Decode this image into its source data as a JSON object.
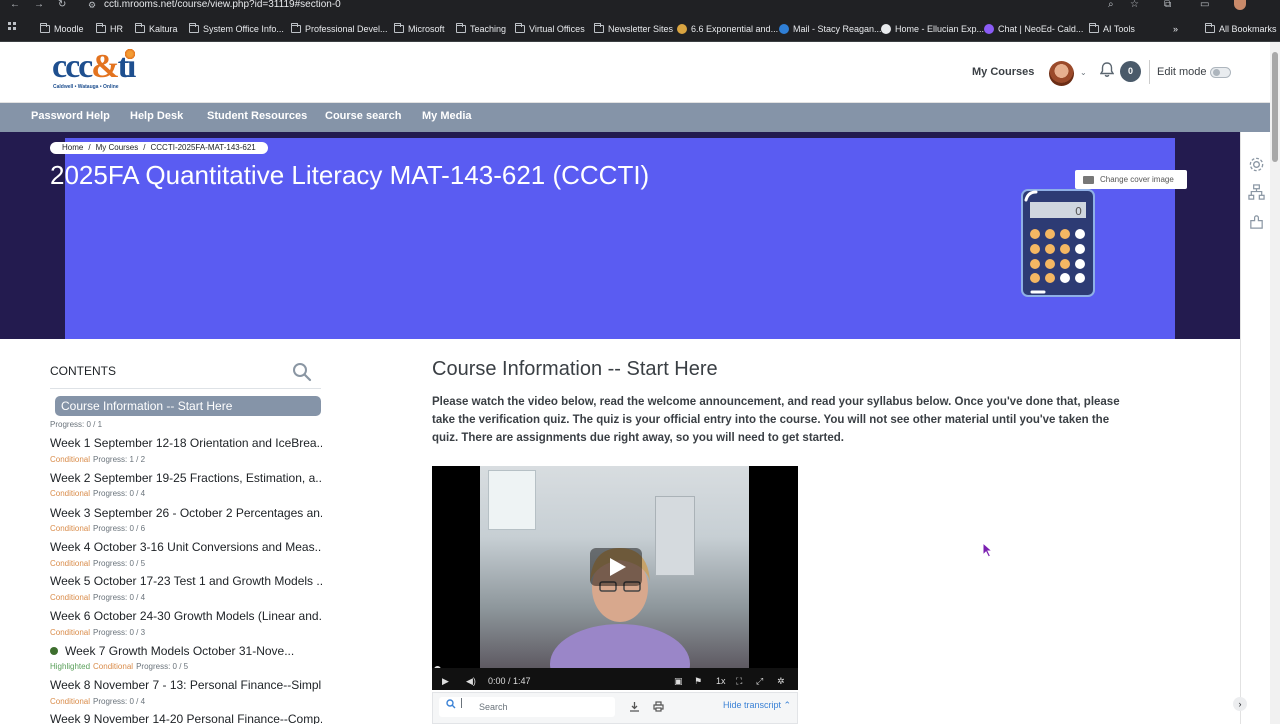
{
  "browser": {
    "url": "ccti.mrooms.net/course/view.php?id=31119#section-0",
    "bookmarks": [
      {
        "label": "Moodle",
        "type": "folder"
      },
      {
        "label": "HR",
        "type": "folder"
      },
      {
        "label": "Kaltura",
        "type": "folder"
      },
      {
        "label": "System Office Info...",
        "type": "folder"
      },
      {
        "label": "Professional Devel...",
        "type": "folder"
      },
      {
        "label": "Microsoft",
        "type": "folder"
      },
      {
        "label": "Teaching",
        "type": "folder"
      },
      {
        "label": "Virtual Offices",
        "type": "folder"
      },
      {
        "label": "Newsletter Sites",
        "type": "folder"
      },
      {
        "label": "6.6 Exponential and...",
        "type": "site"
      },
      {
        "label": "Mail - Stacy Reagan...",
        "type": "site"
      },
      {
        "label": "Home - Ellucian Exp...",
        "type": "site"
      },
      {
        "label": "Chat | NeoEd- Cald...",
        "type": "site"
      },
      {
        "label": "AI Tools",
        "type": "folder"
      }
    ],
    "more": "»",
    "all_bookmarks": "All Bookmarks"
  },
  "header": {
    "logo_text": "ccc&ti",
    "logo_sub": "Caldwell • Watauga • Online",
    "my_courses": "My Courses",
    "messages_count": "0",
    "edit_mode": "Edit mode"
  },
  "subnav": [
    "Password Help",
    "Help Desk",
    "Student Resources",
    "Course search",
    "My Media"
  ],
  "banner": {
    "breadcrumb": [
      "Home",
      "My Courses",
      "CCCTI-2025FA-MAT-143-621"
    ],
    "title": "2025FA Quantitative Literacy MAT-143-621 (CCCTI)",
    "change_cover": "Change cover image",
    "calculator_display": "0"
  },
  "index": {
    "heading": "CONTENTS",
    "active": {
      "label": "Course Information -- Start Here",
      "progress": "Progress: 0 / 1"
    },
    "items": [
      {
        "label": "Week 1 September 12-18 Orientation and IceBrea...",
        "tags": [
          "Conditional"
        ],
        "progress": "Progress: 1 / 2"
      },
      {
        "label": "Week 2 September 19-25 Fractions, Estimation, a...",
        "tags": [
          "Conditional"
        ],
        "progress": "Progress: 0 / 4"
      },
      {
        "label": "Week 3 September 26 - October 2 Percentages an...",
        "tags": [
          "Conditional"
        ],
        "progress": "Progress: 0 / 6"
      },
      {
        "label": "Week 4 October 3-16 Unit Conversions and Meas...",
        "tags": [
          "Conditional"
        ],
        "progress": "Progress: 0 / 5"
      },
      {
        "label": "Week 5 October 17-23 Test 1 and Growth Models ...",
        "tags": [
          "Conditional"
        ],
        "progress": "Progress: 0 / 4"
      },
      {
        "label": "Week 6 October 24-30 Growth Models (Linear and...",
        "tags": [
          "Conditional"
        ],
        "progress": "Progress: 0 / 3"
      },
      {
        "label": "Week 7 Growth Models October 31-Nove...",
        "tags": [
          "Highlighted",
          "Conditional"
        ],
        "progress": "Progress: 0 / 5"
      },
      {
        "label": "Week 8 November 7 - 13: Personal Finance--Simpl...",
        "tags": [
          "Conditional"
        ],
        "progress": "Progress: 0 / 4"
      },
      {
        "label": "Week 9 November 14-20 Personal Finance--Comp...",
        "tags": [],
        "progress": ""
      }
    ]
  },
  "main": {
    "section_title": "Course Information -- Start Here",
    "intro": "Please watch the video below, read the welcome announcement, and read your syllabus below. Once you've done that, please take the verification quiz. The quiz is your official entry into the course. You will not see other material until you've taken the quiz. There are assignments due right away, so you will need to get started.",
    "video": {
      "time": "0:00",
      "duration": "/ 1:47",
      "speed": "1x"
    },
    "transcript": {
      "search_placeholder": "Search",
      "hide": "Hide transcript"
    }
  }
}
